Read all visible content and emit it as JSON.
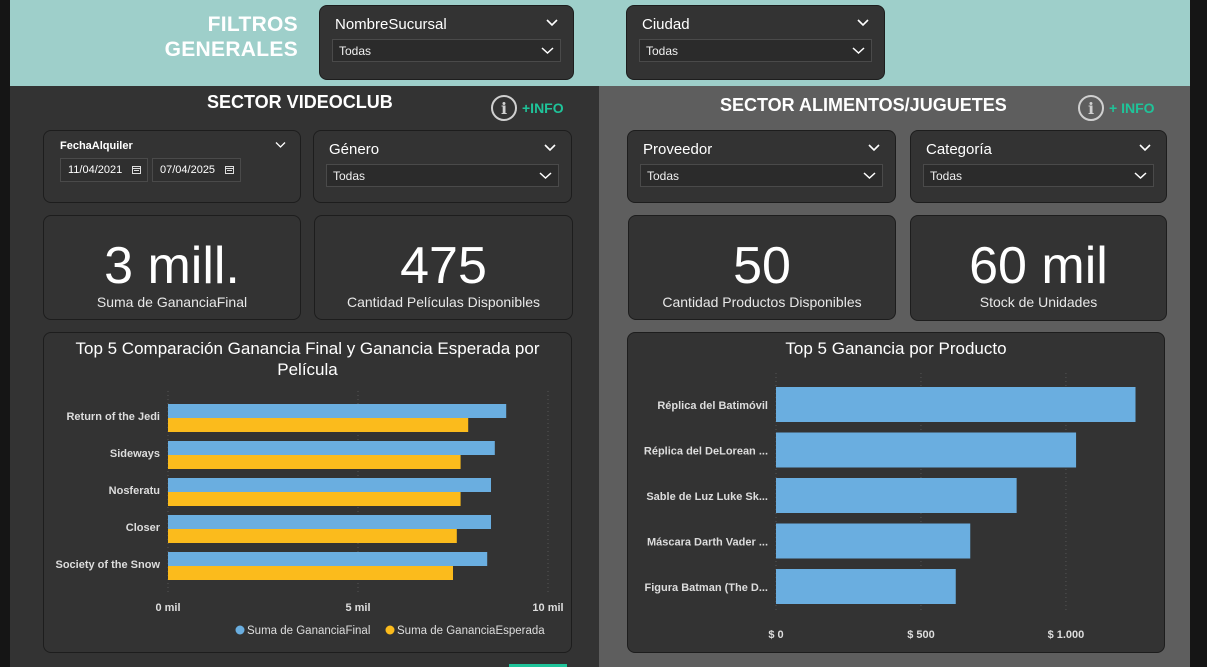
{
  "filters": {
    "title_line1": "FILTROS",
    "title_line2": "GENERALES",
    "sucursal": {
      "label": "NombreSucursal",
      "value": "Todas"
    },
    "ciudad": {
      "label": "Ciudad",
      "value": "Todas"
    }
  },
  "videoclub": {
    "title": "SECTOR VIDEOCLUB",
    "info_label": "+INFO",
    "date_filter": {
      "label": "FechaAlquiler",
      "from": "11/04/2021",
      "to": "07/04/2025"
    },
    "genero": {
      "label": "Género",
      "value": "Todas"
    },
    "kpi_ganancia": {
      "value": "3 mill.",
      "caption": "Suma de GananciaFinal"
    },
    "kpi_peliculas": {
      "value": "475",
      "caption": "Cantidad Películas Disponibles"
    }
  },
  "alimentos": {
    "title": "SECTOR ALIMENTOS/JUGUETES",
    "info_label": "+ INFO",
    "proveedor": {
      "label": "Proveedor",
      "value": "Todas"
    },
    "categoria": {
      "label": "Categoría",
      "value": "Todas"
    },
    "kpi_productos": {
      "value": "50",
      "caption": "Cantidad Productos Disponibles"
    },
    "kpi_stock": {
      "value": "60 mil",
      "caption": "Stock de Unidades"
    }
  },
  "colors": {
    "series1": "#6aaee0",
    "series2": "#fbbb1c",
    "accent": "#1fc49a"
  },
  "chart_data": [
    {
      "type": "bar",
      "orientation": "horizontal",
      "title": "Top 5 Comparación Ganancia Final y Ganancia Esperada por Película",
      "categories": [
        "Return of the Jedi",
        "Sideways",
        "Nosferatu",
        "Closer",
        "Society of the Snow"
      ],
      "series": [
        {
          "name": "Suma de GananciaFinal",
          "values": [
            8.9,
            8.6,
            8.5,
            8.5,
            8.4
          ]
        },
        {
          "name": "Suma de GananciaEsperada",
          "values": [
            7.9,
            7.7,
            7.7,
            7.6,
            7.5
          ]
        }
      ],
      "xticks": [
        "0 mil",
        "5 mil",
        "10 mil"
      ],
      "xlim": [
        0,
        10
      ],
      "legend": "bottom-right",
      "grid": true
    },
    {
      "type": "bar",
      "orientation": "horizontal",
      "title": "Top 5 Ganancia por Producto",
      "categories": [
        "Réplica del Batimóvil",
        "Réplica del DeLorean ...",
        "Sable de Luz Luke Sk...",
        "Máscara Darth Vader ...",
        "Figura Batman (The D..."
      ],
      "series": [
        {
          "values": [
            1240,
            1035,
            830,
            670,
            620
          ]
        }
      ],
      "xticks": [
        "$ 0",
        "$ 500",
        "$ 1.000"
      ],
      "xlim": [
        0,
        1290
      ],
      "grid": true
    }
  ]
}
